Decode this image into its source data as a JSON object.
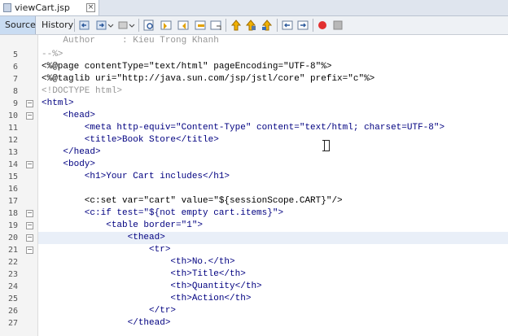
{
  "file_tab": {
    "name": "viewCart.jsp",
    "close": "×"
  },
  "view_tabs": {
    "source": "Source",
    "history": "History"
  },
  "toolbar_icons": [
    "back-icon",
    "forward-icon",
    "last-edit-icon",
    "find-icon",
    "find-prev-icon",
    "find-next-icon",
    "toggle-highlight-icon",
    "toggle-bookmark-icon",
    "prev-bookmark-icon",
    "next-bookmark-icon",
    "shift-left-icon",
    "shift-right-icon",
    "record-macro-icon",
    "stop-macro-icon"
  ],
  "colors": {
    "tag": "#000080",
    "attr": "#007c00",
    "value": "#ce7b00",
    "comment": "#969696",
    "highlight": "#e9eff8",
    "brace_match": "#ffeb3b"
  },
  "lines": [
    {
      "n": "",
      "text": "    Author     : Kieu Trong Khanh"
    },
    {
      "n": "5",
      "text": "--%>"
    },
    {
      "n": "6",
      "text": "<%@page contentType=\"text/html\" pageEncoding=\"UTF-8\"%>"
    },
    {
      "n": "7",
      "text": "<%@taglib uri=\"http://java.sun.com/jsp/jstl/core\" prefix=\"c\"%>"
    },
    {
      "n": "8",
      "text": "<!DOCTYPE html>"
    },
    {
      "n": "9",
      "text": "<html>"
    },
    {
      "n": "10",
      "text": "    <head>"
    },
    {
      "n": "11",
      "text": "        <meta http-equiv=\"Content-Type\" content=\"text/html; charset=UTF-8\">"
    },
    {
      "n": "12",
      "text": "        <title>Book Store</title>"
    },
    {
      "n": "13",
      "text": "    </head>"
    },
    {
      "n": "14",
      "text": "    <body>"
    },
    {
      "n": "15",
      "text": "        <h1>Your Cart includes</h1>"
    },
    {
      "n": "16",
      "text": ""
    },
    {
      "n": "17",
      "text": "        <c:set var=\"cart\" value=\"${sessionScope.CART}\"/>"
    },
    {
      "n": "18",
      "text": "        <c:if test=\"${not empty cart.items}\">"
    },
    {
      "n": "19",
      "text": "            <table border=\"1\">"
    },
    {
      "n": "20",
      "text": "                <thead>"
    },
    {
      "n": "21",
      "text": "                    <tr>"
    },
    {
      "n": "22",
      "text": "                        <th>No.</th>"
    },
    {
      "n": "23",
      "text": "                        <th>Title</th>"
    },
    {
      "n": "24",
      "text": "                        <th>Quantity</th>"
    },
    {
      "n": "25",
      "text": "                        <th>Action</th>"
    },
    {
      "n": "26",
      "text": "                    </tr>"
    },
    {
      "n": "27",
      "text": "                </thead>"
    }
  ]
}
